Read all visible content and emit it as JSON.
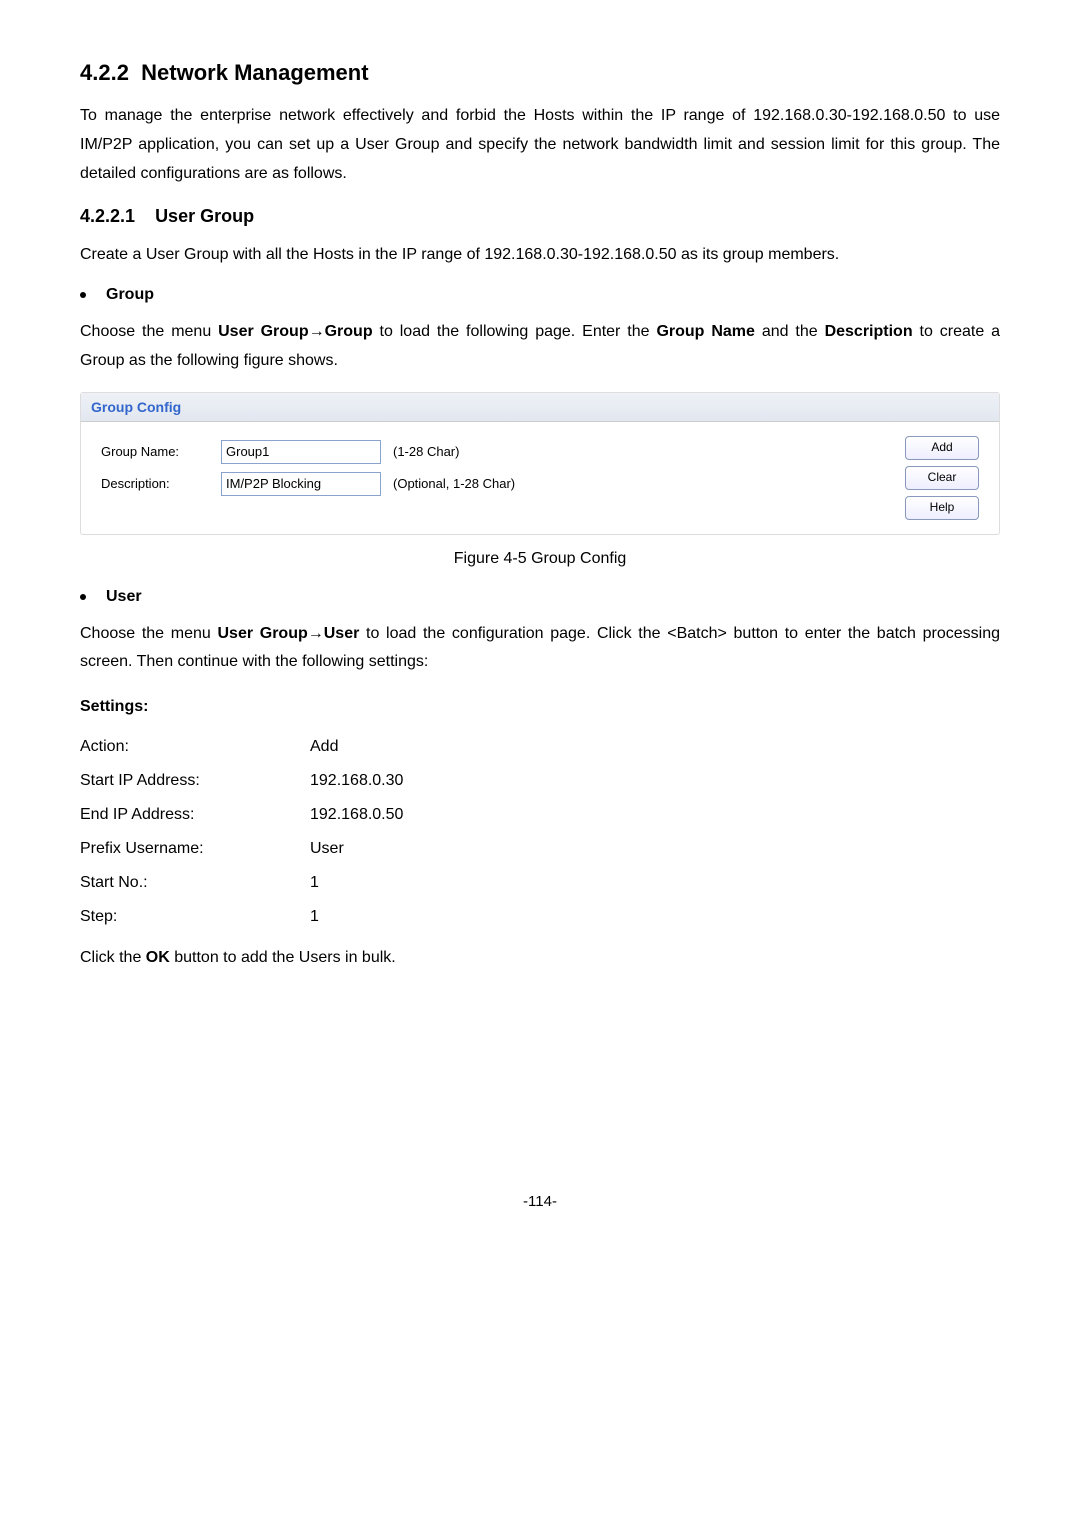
{
  "section": {
    "num": "4.2.2",
    "title": "Network Management"
  },
  "intro": "To manage the enterprise network effectively and forbid the Hosts within the IP range of 192.168.0.30-192.168.0.50 to use IM/P2P application, you can set up a User Group and specify the network bandwidth limit and session limit for this group. The detailed configurations are as follows.",
  "sub1": {
    "num": "4.2.2.1",
    "title": "User Group"
  },
  "sub1_text": "Create a User Group with all the Hosts in the IP range of 192.168.0.30-192.168.0.50 as its group members.",
  "bullet_group": "Group",
  "group_para_a": "Choose the menu ",
  "group_para_b": "User Group→Group",
  "group_para_c": " to load the following page. Enter the ",
  "group_para_d": "Group Name",
  "group_para_e": " and the ",
  "group_para_f": "Description",
  "group_para_g": " to create a Group as the following figure shows.",
  "panel": {
    "header": "Group Config",
    "group_name_label": "Group Name:",
    "group_name_value": "Group1",
    "group_name_hint": "(1-28 Char)",
    "desc_label": "Description:",
    "desc_value": "IM/P2P Blocking",
    "desc_hint": "(Optional, 1-28 Char)",
    "btn_add": "Add",
    "btn_clear": "Clear",
    "btn_help": "Help"
  },
  "fig_caption": "Figure 4-5 Group Config",
  "bullet_user": "User",
  "user_para_a": "Choose the menu ",
  "user_para_b": "User Group→User",
  "user_para_c": " to load the configuration page. Click the <Batch> button to enter the batch processing screen. Then continue with the following settings:",
  "settings_hdr": "Settings:",
  "settings": {
    "action_l": "Action:",
    "action_v": "Add",
    "sip_l": "Start IP Address:",
    "sip_v": "192.168.0.30",
    "eip_l": "End IP Address:",
    "eip_v": "192.168.0.50",
    "pu_l": "Prefix Username:",
    "pu_v": "User",
    "sn_l": "Start No.:",
    "sn_v": "1",
    "st_l": "Step:",
    "st_v": "1"
  },
  "final_a": "Click the ",
  "final_b": "OK",
  "final_c": " button to add the Users in bulk.",
  "page_num": "-114-"
}
